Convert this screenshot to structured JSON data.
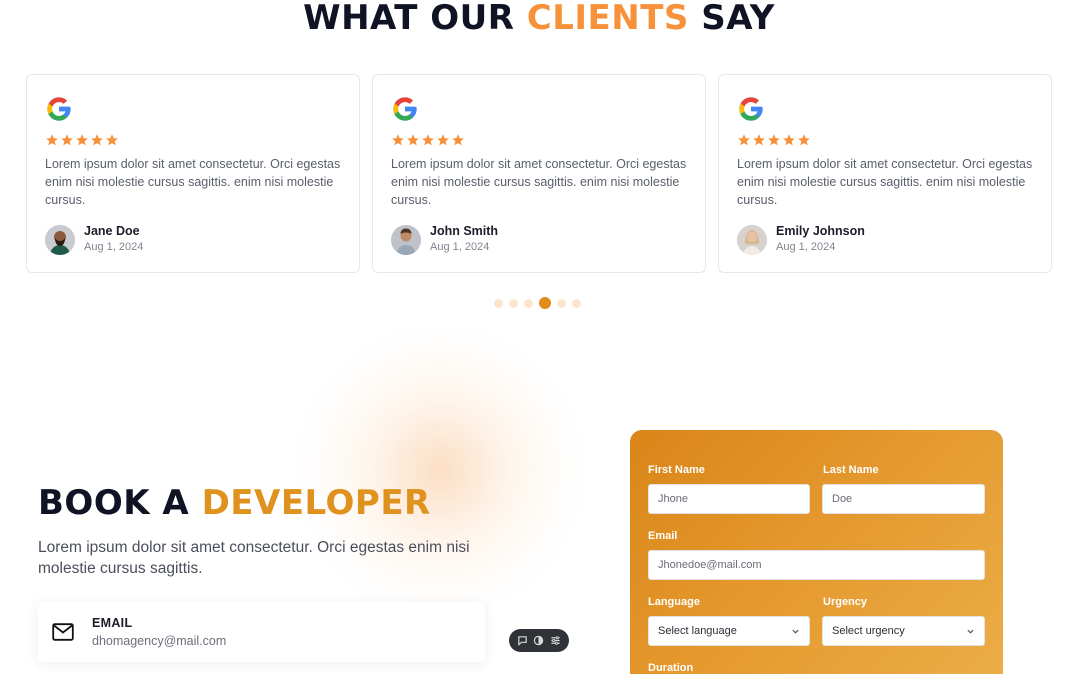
{
  "testimonials": {
    "title_prefix": "WHAT OUR",
    "title_accent": "CLIENTS",
    "title_suffix": "SAY",
    "cards": [
      {
        "review": "Lorem ipsum dolor sit amet consectetur. Orci egestas enim nisi molestie cursus sagittis. enim nisi molestie cursus.",
        "name": "Jane Doe",
        "date": "Aug 1, 2024",
        "rating": 5
      },
      {
        "review": "Lorem ipsum dolor sit amet consectetur. Orci egestas enim nisi molestie cursus sagittis. enim nisi molestie cursus.",
        "name": "John Smith",
        "date": "Aug 1, 2024",
        "rating": 5
      },
      {
        "review": "Lorem ipsum dolor sit amet consectetur. Orci egestas enim nisi molestie cursus sagittis. enim nisi molestie cursus.",
        "name": "Emily Johnson",
        "date": "Aug 1, 2024",
        "rating": 5
      }
    ],
    "pagination": {
      "total": 6,
      "active_index": 3
    },
    "icons": {
      "source": "google-icon",
      "rating": "star-icon"
    },
    "star_color": "#f7923a"
  },
  "book": {
    "title_prefix": "BOOK A",
    "title_accent": "DEVELOPER",
    "description": "Lorem ipsum dolor sit amet consectetur. Orci egestas enim nisi molestie cursus sagittis.",
    "contact": {
      "label": "EMAIL",
      "value": "dhomagency@mail.com",
      "icon": "mail-icon"
    }
  },
  "form": {
    "first_name_label": "First Name",
    "first_name_placeholder": "Jhone",
    "last_name_label": "Last Name",
    "last_name_placeholder": "Doe",
    "email_label": "Email",
    "email_placeholder": "Jhonedoe@mail.com",
    "language_label": "Language",
    "language_value": "Select language",
    "urgency_label": "Urgency",
    "urgency_value": "Select urgency",
    "duration_label": "Duration"
  },
  "colors": {
    "accent": "#f7923a",
    "accent_dark": "#e0921e",
    "heading": "#0f1324",
    "form_gradient_start": "#d98518",
    "form_gradient_end": "#ecae48"
  }
}
